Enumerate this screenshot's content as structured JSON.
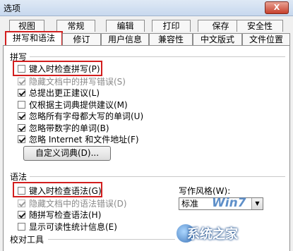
{
  "window": {
    "title": "选项",
    "close_label": "X"
  },
  "tabs_row1": [
    "视图",
    "常规",
    "编辑",
    "打印",
    "保存",
    "安全性"
  ],
  "tabs_row2": [
    "拼写和语法",
    "修订",
    "用户信息",
    "兼容性",
    "中文版式",
    "文件位置"
  ],
  "spelling": {
    "group_label": "拼写",
    "options": [
      {
        "label": "键入时检查拼写(P)",
        "checked": false,
        "disabled": false
      },
      {
        "label": "隐藏文档中的拼写错误(S)",
        "checked": true,
        "disabled": true
      },
      {
        "label": "总提出更正建议(L)",
        "checked": true,
        "disabled": false
      },
      {
        "label": "仅根据主词典提供建议(M)",
        "checked": false,
        "disabled": false
      },
      {
        "label": "忽略所有字母都大写的单词(U)",
        "checked": true,
        "disabled": false
      },
      {
        "label": "忽略带数字的单词(B)",
        "checked": true,
        "disabled": false
      },
      {
        "label": "忽略 Internet 和文件地址(F)",
        "checked": true,
        "disabled": false
      }
    ],
    "custom_dict_button": "自定义词典(D)..."
  },
  "grammar": {
    "group_label": "语法",
    "options": [
      {
        "label": "键入时检查语法(G)",
        "checked": false,
        "disabled": false
      },
      {
        "label": "隐藏文档中的语法错误(D)",
        "checked": true,
        "disabled": true
      },
      {
        "label": "随拼写检查语法(H)",
        "checked": true,
        "disabled": false
      },
      {
        "label": "显示可读性统计信息(E)",
        "checked": false,
        "disabled": false
      }
    ],
    "writing_style_label": "写作风格(W):",
    "writing_style_value": "标准"
  },
  "proofing": {
    "group_label": "校对工具"
  },
  "watermark": {
    "logo": "Win7",
    "site": "系统之家"
  }
}
